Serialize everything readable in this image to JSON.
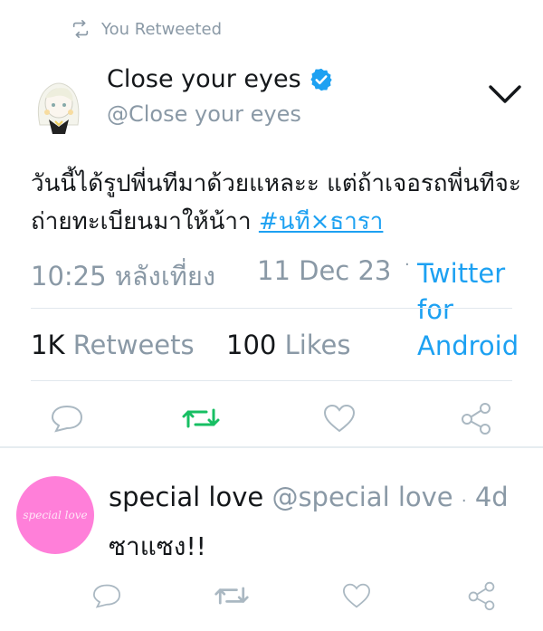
{
  "retweet_context": {
    "label": "You Retweeted",
    "icon": "retweet-icon"
  },
  "tweet": {
    "author_name": "Close your eyes",
    "verified": true,
    "author_handle": "@Close your eyes",
    "text_part1": "วันนี้ได้รูปพี่นทีมาด้วยแหละะ แต่ถ้าเจอรถพี่นทีจะถ่ายทะเบียนมาให้น้าา ",
    "hashtag": "#นที×ธารา",
    "time": "10:25 หลังเที่ยง",
    "date": "11 Dec 23",
    "source": "Twitter for Android",
    "separator": "·",
    "retweets_count": "1K",
    "retweets_label": "Retweets",
    "likes_count": "100",
    "likes_label": "Likes"
  },
  "reply": {
    "avatar_text": "special love",
    "name": "special love",
    "handle": "@special love",
    "separator": "·",
    "age": "4d",
    "text": "ซาแซง!!"
  },
  "colors": {
    "accent": "#1da1f2",
    "retweet_active": "#17bf63",
    "muted": "#8a99a6",
    "avatar_pink": "#ff7fd9"
  }
}
